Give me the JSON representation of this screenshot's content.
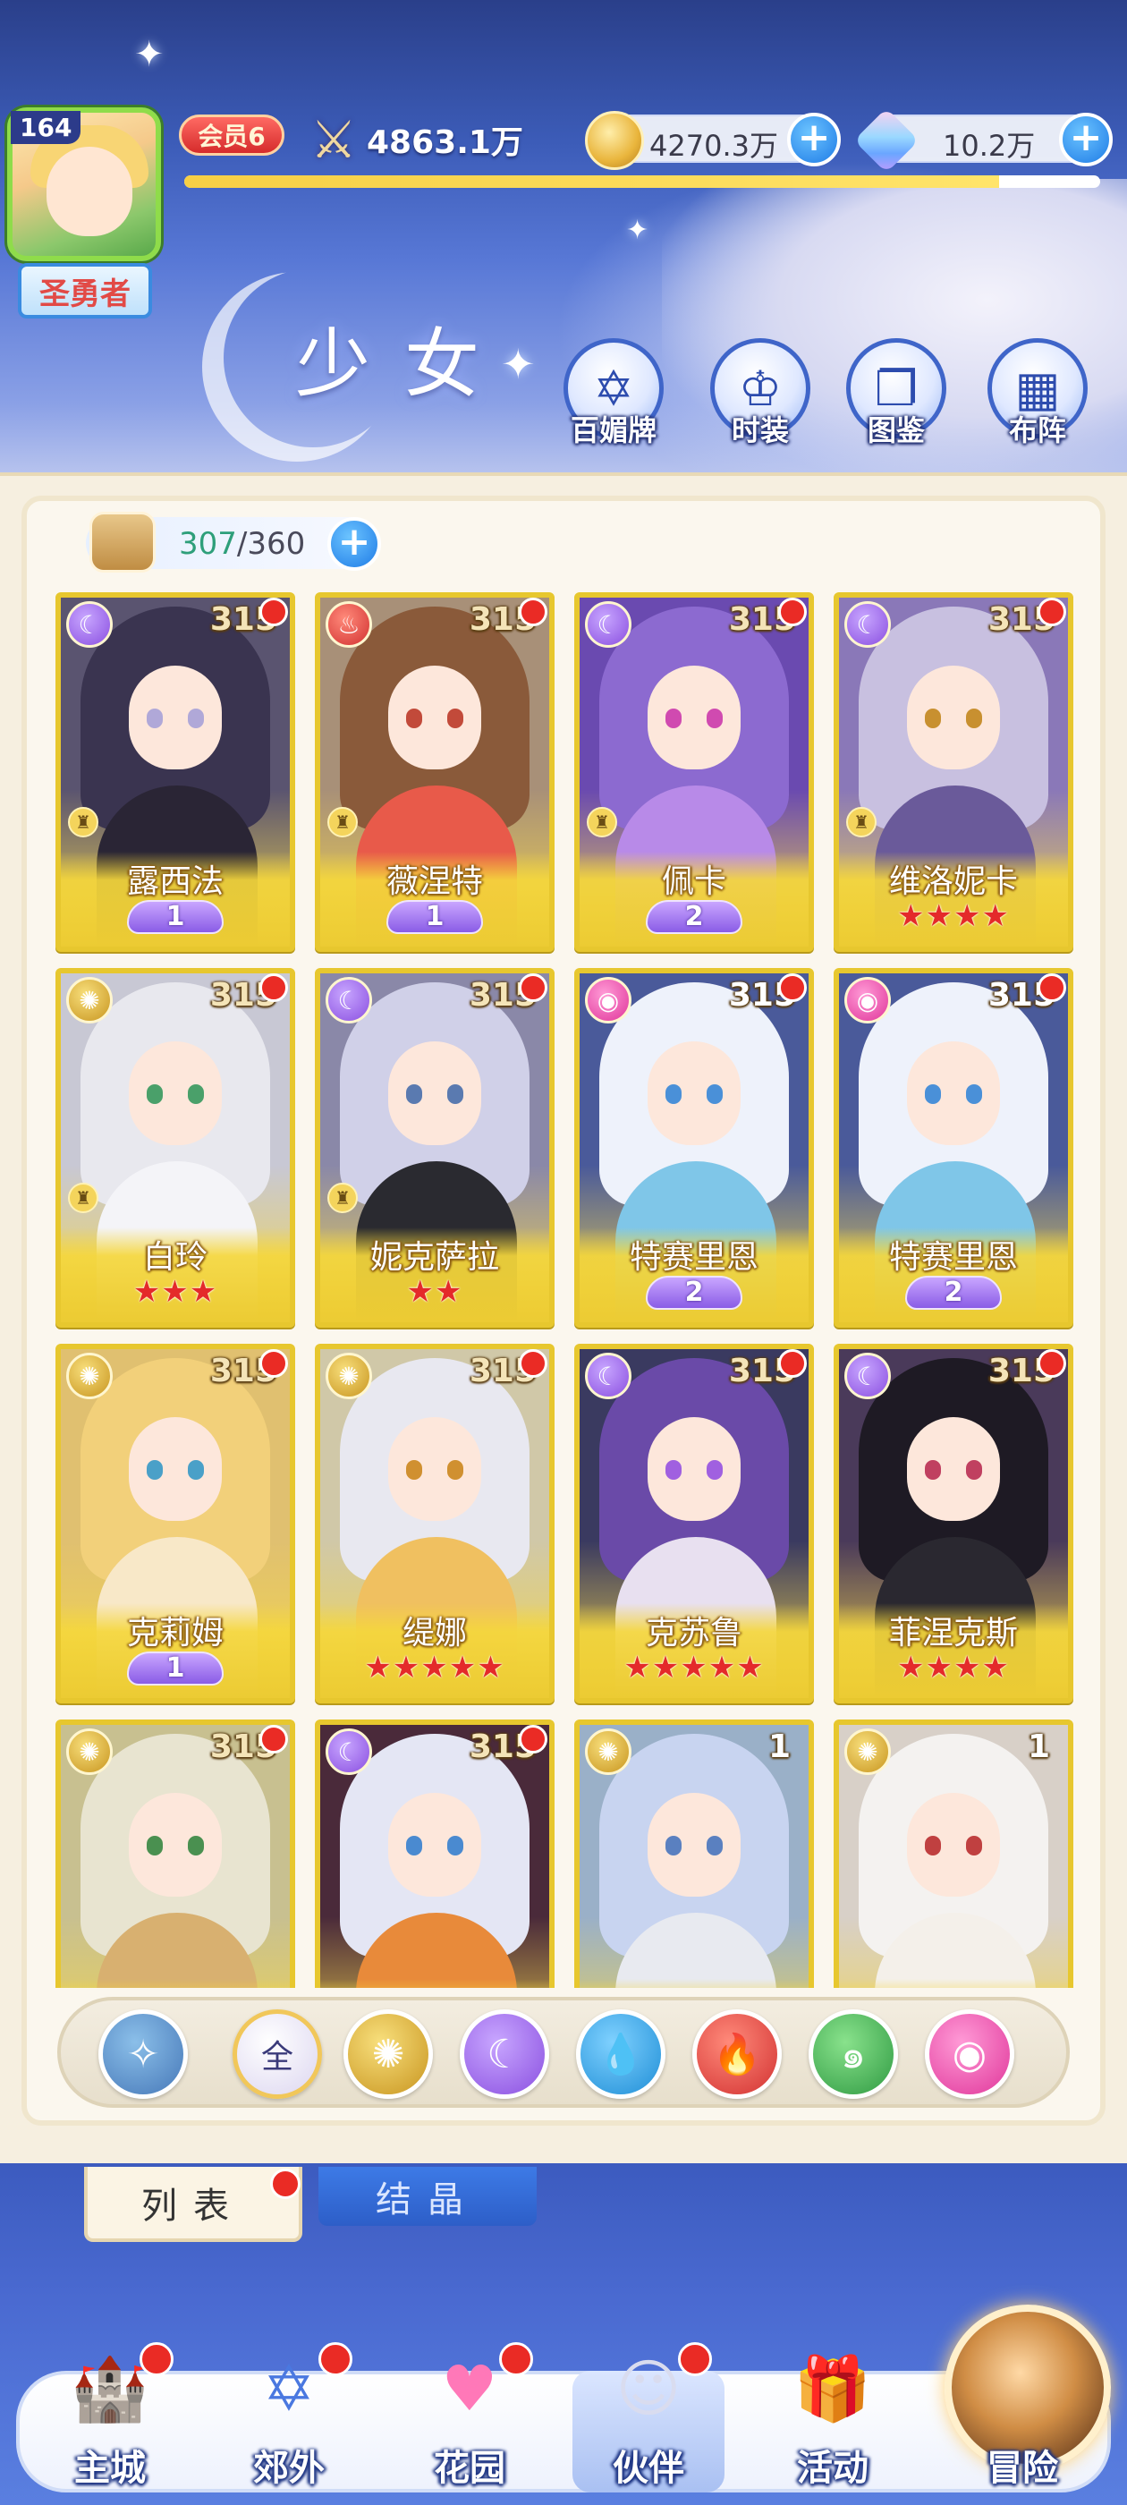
{
  "header": {
    "level": "164",
    "player_title": "圣勇者",
    "vip": "会员6",
    "power": "4863.1万",
    "exp_fraction": 0.89,
    "gold": "4270.3万",
    "gems": "10.2万",
    "page_title": "少女",
    "quick_nav": [
      {
        "label": "百媚牌",
        "icon": "card-icon"
      },
      {
        "label": "时装",
        "icon": "outfit-icon"
      },
      {
        "label": "图鉴",
        "icon": "book-icon"
      },
      {
        "label": "布阵",
        "icon": "grid-icon"
      }
    ]
  },
  "capacity": {
    "current": "307",
    "max": "360"
  },
  "cards": [
    {
      "name": "露西法",
      "level": "315",
      "element": "moon",
      "rank": "1",
      "stars": "",
      "rook": true
    },
    {
      "name": "薇涅特",
      "level": "315",
      "element": "fire",
      "rank": "1",
      "stars": "",
      "rook": true
    },
    {
      "name": "佩卡",
      "level": "315",
      "element": "moon",
      "rank": "2",
      "stars": "",
      "rook": true
    },
    {
      "name": "维洛妮卡",
      "level": "315",
      "element": "moon",
      "rank": "",
      "stars": "★★★★",
      "rook": true
    },
    {
      "name": "白玲",
      "level": "315",
      "element": "sun",
      "rank": "",
      "stars": "★★★",
      "rook": true
    },
    {
      "name": "妮克萨拉",
      "level": "315",
      "element": "moon",
      "rank": "",
      "stars": "★★",
      "rook": true
    },
    {
      "name": "特赛里恩",
      "level": "315",
      "element": "heart",
      "rank": "2",
      "stars": "",
      "rook": false
    },
    {
      "name": "特赛里恩",
      "level": "315",
      "element": "heart",
      "rank": "2",
      "stars": "",
      "rook": false
    },
    {
      "name": "克莉姆",
      "level": "315",
      "element": "sun",
      "rank": "1",
      "stars": "",
      "rook": false
    },
    {
      "name": "缇娜",
      "level": "315",
      "element": "sun",
      "rank": "",
      "stars": "★★★★★",
      "rook": false
    },
    {
      "name": "克苏鲁",
      "level": "315",
      "element": "moon",
      "rank": "",
      "stars": "★★★★★",
      "rook": false
    },
    {
      "name": "菲涅克斯",
      "level": "315",
      "element": "moon",
      "rank": "",
      "stars": "★★★★",
      "rook": false
    },
    {
      "name": "",
      "level": "315",
      "element": "sun",
      "rank": "",
      "stars": "",
      "rook": false
    },
    {
      "name": "",
      "level": "315",
      "element": "moon",
      "rank": "",
      "stars": "",
      "rook": false
    },
    {
      "name": "",
      "level": "1",
      "element": "sun",
      "rank": "",
      "stars": "",
      "rook": false
    },
    {
      "name": "",
      "level": "1",
      "element": "sun",
      "rank": "",
      "stars": "",
      "rook": false
    }
  ],
  "filters": [
    {
      "label": "",
      "icon": "wing-icon"
    },
    {
      "label": "全",
      "icon": "all-icon"
    },
    {
      "label": "",
      "icon": "sun-icon"
    },
    {
      "label": "",
      "icon": "moon-icon"
    },
    {
      "label": "",
      "icon": "water-icon"
    },
    {
      "label": "",
      "icon": "fire-icon"
    },
    {
      "label": "",
      "icon": "wind-icon"
    },
    {
      "label": "",
      "icon": "heart-icon"
    }
  ],
  "subtabs": {
    "list": "列表",
    "crystal": "结晶"
  },
  "bottom_nav": [
    {
      "label": "主城",
      "icon": "castle-icon"
    },
    {
      "label": "郊外",
      "icon": "portal-icon"
    },
    {
      "label": "花园",
      "icon": "heart-garden-icon"
    },
    {
      "label": "伙伴",
      "icon": "partner-icon"
    },
    {
      "label": "活动",
      "icon": "gift-icon"
    },
    {
      "label": "冒险",
      "icon": "adventure-icon"
    }
  ],
  "colors": {
    "card_gold": "#f3d64c",
    "red_dot": "#ea2b25",
    "accent_blue": "#1e7be6"
  }
}
